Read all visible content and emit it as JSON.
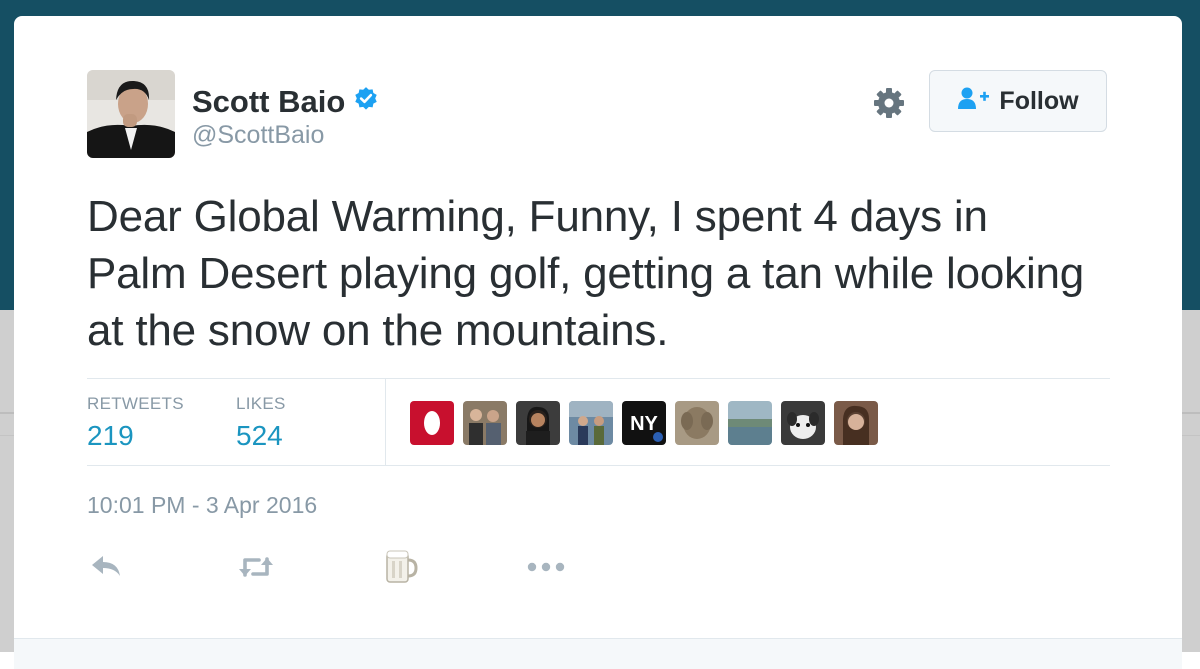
{
  "user": {
    "name": "Scott Baio",
    "handle": "@ScottBaio"
  },
  "follow_button": {
    "label": "Follow"
  },
  "tweet": {
    "text": "Dear Global Warming, Funny, I spent 4 days in Palm Desert playing golf, getting a tan while looking at the snow on the mountains.",
    "timestamp": "10:01 PM - 3 Apr 2016"
  },
  "stats": {
    "retweets_label": "RETWEETS",
    "retweets": "219",
    "likes_label": "LIKES",
    "likes": "524"
  },
  "likers_count_shown": 9,
  "colors": {
    "header_background": "#154f63",
    "verified_badge": "#1da1f2",
    "stat_value": "#1b95c0",
    "secondary_text": "#8899a6",
    "primary_text": "#292f33"
  },
  "icons": [
    "verified-badge-icon",
    "gear-icon",
    "follow-user-icon",
    "reply-icon",
    "retweet-icon",
    "like-beer-mug-icon",
    "more-dots-icon"
  ]
}
